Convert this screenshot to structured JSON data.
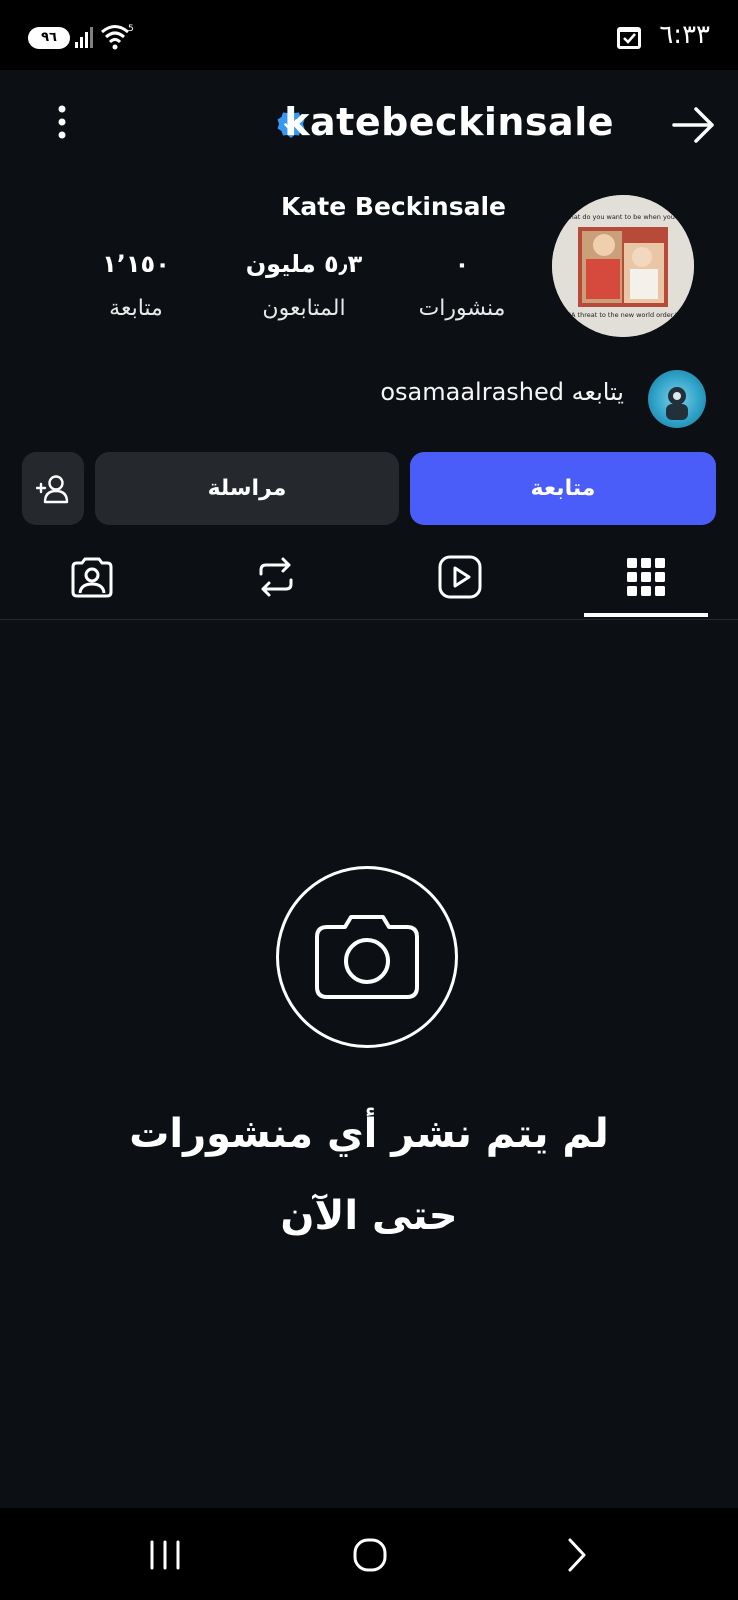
{
  "status_bar": {
    "time": "٦:٣٣",
    "battery": "٩٦",
    "wifi_badge": "5"
  },
  "header": {
    "username": "katebeckinsale"
  },
  "profile": {
    "full_name": "Kate Beckinsale",
    "avatar_caption_top": "\"Honey, what do you want to be when you grow up?\"",
    "avatar_caption_bottom": "\"A threat to the new world order.\"",
    "stats": {
      "posts": {
        "value": "٠",
        "label": "منشورات"
      },
      "followers": {
        "value": "٥٫٣ مليون",
        "label": "المتابعون"
      },
      "following": {
        "value": "١٬١٥٠",
        "label": "متابعة"
      }
    },
    "followed_by": "يتابعه osamaalrashed"
  },
  "actions": {
    "follow_label": "متابعة",
    "message_label": "مراسلة"
  },
  "tabs": [
    "posts-grid",
    "reels",
    "reposts",
    "tagged"
  ],
  "empty_state": {
    "line1": "لم يتم نشر أي منشورات",
    "line2": "حتى الآن"
  },
  "colors": {
    "background": "#0c1014",
    "accent": "#4a5df9",
    "secondary_button": "#25292e",
    "verified": "#3897f0"
  }
}
